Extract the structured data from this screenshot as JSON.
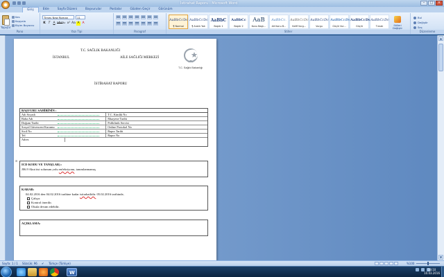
{
  "window": {
    "title": "İstirahat Raporu - Microsoft Word",
    "controls": [
      "–",
      "□",
      "×"
    ]
  },
  "ribbon_tabs": [
    "Giriş",
    "Ekle",
    "Sayfa Düzeni",
    "Başvurular",
    "Postalar",
    "Gözden Geçir",
    "Görünüm"
  ],
  "clipboard": {
    "paste_label": "Yapıştır",
    "cut": "Kes",
    "copy": "Kopyala",
    "format_painter": "Biçim Boyacısı",
    "group_label": "Pano"
  },
  "font": {
    "family": "Times New Roman",
    "size": "11",
    "buttons": [
      "K",
      "T",
      "A",
      "abc",
      "x₂",
      "x²",
      "Aa",
      "A",
      "A"
    ],
    "group_label": "Yazı Tipi"
  },
  "paragraph": {
    "group_label": "Paragraf"
  },
  "styles": {
    "items": [
      {
        "sample": "AaBbCcDc",
        "name": "¶ Normal"
      },
      {
        "sample": "AaBbCcDc",
        "name": "¶ Aralık Yok"
      },
      {
        "sample": "AaBbC",
        "name": "Başlık 1"
      },
      {
        "sample": "AaBbCc",
        "name": "Başlık 2"
      },
      {
        "sample": "AaB",
        "name": "Konu Başlı..."
      },
      {
        "sample": "AaBbCc.",
        "name": "Alt Konu B..."
      },
      {
        "sample": "AaBbCcDc",
        "name": "Hafif Vurg..."
      },
      {
        "sample": "AaBbCcDc",
        "name": "Vurgu"
      },
      {
        "sample": "AaBbCcDc",
        "name": "Güçlü Vur..."
      },
      {
        "sample": "AaBbCcDc",
        "name": "Güçlü"
      },
      {
        "sample": "AaBbCcDc",
        "name": "Tırnak"
      },
      {
        "sample": "AaBbCcDc",
        "name": "Keskin Tır..."
      }
    ],
    "change_label": "Stilleri Değiştir",
    "group_label": "Stiller"
  },
  "editing": {
    "find": "Bul",
    "replace": "Değiştir",
    "select": "Seç",
    "group_label": "Düzenleme"
  },
  "document": {
    "ministry": "T.C. SAĞLIK BAKANLIĞI",
    "city": "İSTANBUL",
    "center": "AİLE SAĞLIĞI MERKEZİ",
    "logo_text": "T.C. Sağlık Bakanlığı",
    "title": "İSTİRAHAT RAPORU",
    "applicant_header": "BAŞVURU SAHİBİNİN :",
    "applicant_rows": [
      {
        "left": "Adı Soyadı",
        "right": "T.C. Kimlik No"
      },
      {
        "left": "Baba Adı",
        "right": "Muayene Tarihi"
      },
      {
        "left": "Doğum Tarihi",
        "right": "Poliklinik Servisi"
      },
      {
        "left": "Sosyal Güvenceni Kurumu",
        "right": "Online Protokol No"
      },
      {
        "left": "Sicil No",
        "right": "Rapor Tarihi"
      },
      {
        "left": "Tel",
        "right": "Rapor No"
      }
    ],
    "address_label": "Adres",
    "icd_label": "ICD KODU VE TANI(LAR) :",
    "icd_prefix": "J06.9 Akut üst solunum yolu ",
    "icd_misspelled": "enfeksiyonu",
    "icd_suffix": ", tanımlanmamış",
    "decision_label": "KARAR:",
    "decision_prefix": "04.02.2016 den 04.02.2016 tarihine kadar ",
    "decision_misspelled": "istirahatlidir.",
    "decision_suffix": " 05.02.2016 tarihinde,",
    "options": [
      "Çalışır.",
      "Kontrol önerilir.",
      "Okula devam edebilir."
    ],
    "notes_label": "AÇIKLAMA:"
  },
  "status": {
    "page": "Sayfa: 1 / 1",
    "words": "Sözcük: 96",
    "language": "Türkçe (Türkiye)",
    "zoom": "%100"
  },
  "taskbar": {
    "time": "18:10",
    "date": "10.03.2016"
  }
}
